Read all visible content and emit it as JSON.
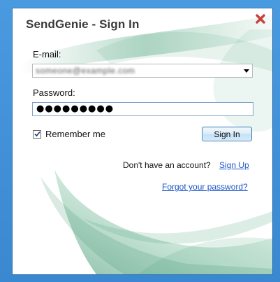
{
  "dialog": {
    "title": "SendGenie - Sign In"
  },
  "form": {
    "email_label": "E-mail:",
    "email_value": "someone@example.com",
    "password_label": "Password:",
    "password_value": "●●●●●●●●●",
    "remember_label": "Remember me",
    "remember_checked": true,
    "signin_label": "Sign In"
  },
  "links": {
    "no_account_text": "Don't have an account?",
    "signup_label": "Sign Up",
    "forgot_label": "Forgot your password?"
  },
  "icons": {
    "close": "close-icon",
    "dropdown": "chevron-down-icon",
    "check": "check-icon"
  },
  "colors": {
    "window_border": "#3d8fd6",
    "close_red": "#c9403a",
    "link": "#1a55c9",
    "swirl_green": "#3f9c72"
  }
}
